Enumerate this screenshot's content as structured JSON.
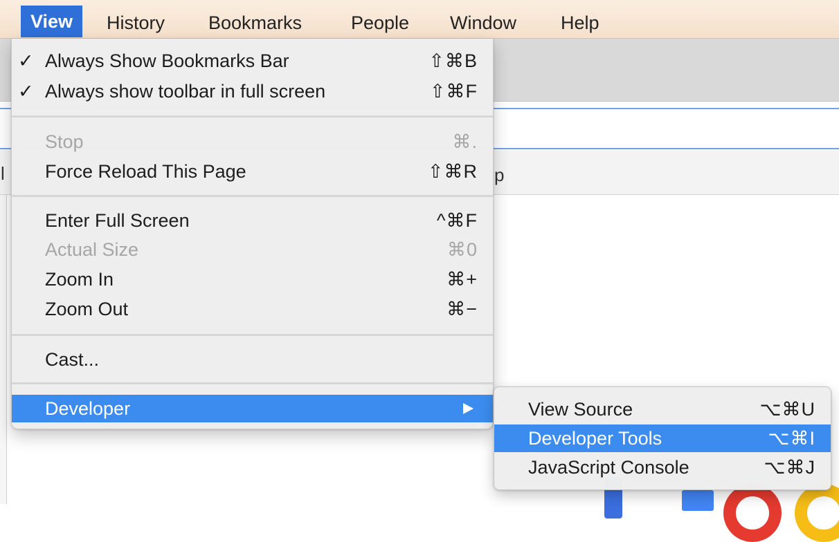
{
  "menubar": {
    "items": [
      {
        "label": "View",
        "active": true
      },
      {
        "label": "History"
      },
      {
        "label": "Bookmarks"
      },
      {
        "label": "People"
      },
      {
        "label": "Window"
      },
      {
        "label": "Help"
      }
    ]
  },
  "view_menu": {
    "always_show_bookmarks_bar": {
      "check": "✓",
      "label": "Always Show Bookmarks Bar",
      "shortcut": "⇧⌘B"
    },
    "always_show_toolbar": {
      "check": "✓",
      "label": "Always show toolbar in full screen",
      "shortcut": "⇧⌘F"
    },
    "stop": {
      "label": "Stop",
      "shortcut": "⌘.",
      "disabled": true
    },
    "force_reload": {
      "label": "Force Reload This Page",
      "shortcut": "⇧⌘R"
    },
    "enter_full_screen": {
      "label": "Enter Full Screen",
      "shortcut": "^⌘F"
    },
    "actual_size": {
      "label": "Actual Size",
      "shortcut": "⌘0",
      "disabled": true
    },
    "zoom_in": {
      "label": "Zoom In",
      "shortcut": "⌘+"
    },
    "zoom_out": {
      "label": "Zoom Out",
      "shortcut": "⌘−"
    },
    "cast": {
      "label": "Cast..."
    },
    "developer": {
      "label": "Developer",
      "highlighted": true
    }
  },
  "developer_submenu": {
    "view_source": {
      "label": "View Source",
      "shortcut": "⌥⌘U"
    },
    "developer_tools": {
      "label": "Developer Tools",
      "shortcut": "⌥⌘I",
      "highlighted": true
    },
    "javascript_console": {
      "label": "JavaScript Console",
      "shortcut": "⌥⌘J"
    }
  },
  "background": {
    "bookmarks_fragment_left": "l",
    "bookmarks_fragment_right": "p"
  },
  "colors": {
    "selection": "#3c8cf0",
    "menubar_active": "#2f6fd8",
    "disabled_text": "#a6a6a6",
    "focus_line": "#6ea2e6"
  }
}
